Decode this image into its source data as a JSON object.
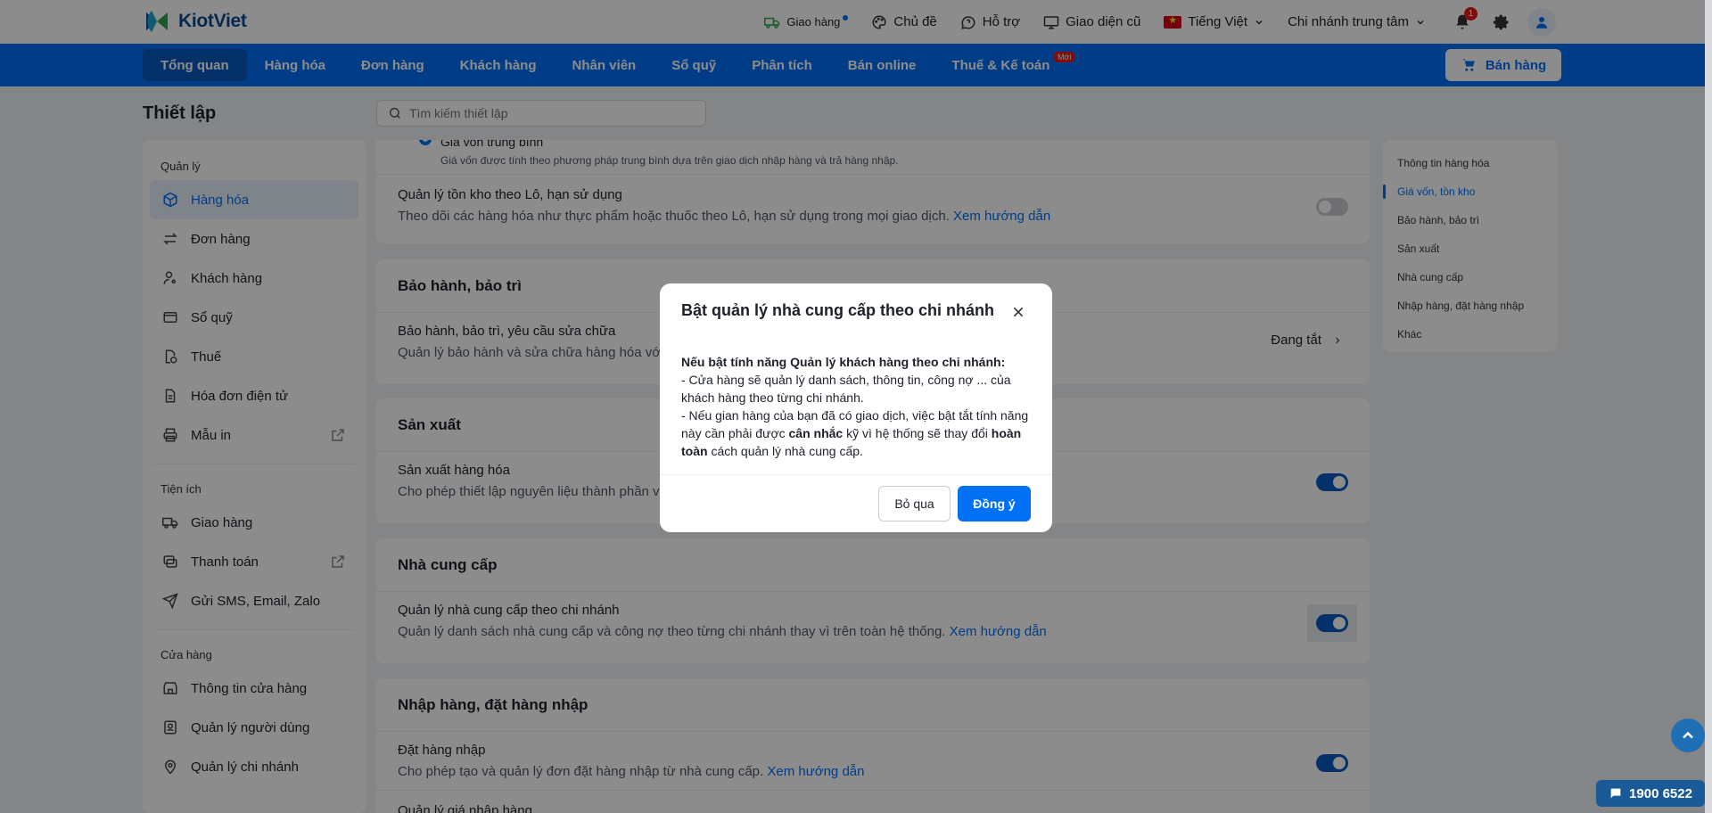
{
  "topbar": {
    "brand": "KiotViet",
    "delivery": "Giao hàng",
    "theme": "Chủ đề",
    "support": "Hỗ trợ",
    "old_ui": "Giao diện cũ",
    "language": "Tiếng Việt",
    "branch": "Chi nhánh trung tâm",
    "notification_count": "1"
  },
  "nav": {
    "items": [
      "Tổng quan",
      "Hàng hóa",
      "Đơn hàng",
      "Khách hàng",
      "Nhân viên",
      "Sổ quỹ",
      "Phân tích",
      "Bán online",
      "Thuế & Kế toán"
    ],
    "new_tag": "Mới",
    "sell_button": "Bán hàng"
  },
  "page": {
    "title": "Thiết lập",
    "search_placeholder": "Tìm kiếm thiết lập"
  },
  "sidebar": {
    "groups": [
      {
        "title": "Quản lý",
        "items": [
          "Hàng hóa",
          "Đơn hàng",
          "Khách hàng",
          "Sổ quỹ",
          "Thuế",
          "Hóa đơn điện tử",
          "Mẫu in"
        ]
      },
      {
        "title": "Tiện ích",
        "items": [
          "Giao hàng",
          "Thanh toán",
          "Gửi SMS, Email, Zalo"
        ]
      },
      {
        "title": "Cửa hàng",
        "items": [
          "Thông tin cửa hàng",
          "Quản lý người dùng",
          "Quản lý chi nhánh"
        ]
      }
    ]
  },
  "content": {
    "cost_option_title": "Giá vốn trung bình",
    "cost_option_desc": "Giá vốn được tính theo phương pháp trung bình dựa trên giao dịch nhập hàng và trả hàng nhập.",
    "lot_title": "Quản lý tồn kho theo Lô, hạn sử dụng",
    "lot_desc": "Theo dõi các hàng hóa như thực phẩm hoặc thuốc theo Lô, hạn sử dụng trong mọi giao dịch.",
    "guide_link": "Xem hướng dẫn",
    "warranty_head": "Bảo hành, bảo trì",
    "warranty_title": "Bảo hành, bảo trì, yêu cầu sửa chữa",
    "warranty_desc": "Quản lý bảo hành và sửa chữa hàng hóa với",
    "warranty_status": "Đang tắt",
    "production_head": "Sản xuất",
    "production_title": "Sản xuất hàng hóa",
    "production_desc": "Cho phép thiết lập nguyên liệu thành phần và",
    "supplier_head": "Nhà cung cấp",
    "supplier_title": "Quản lý nhà cung cấp theo chi nhánh",
    "supplier_desc": "Quản lý danh sách nhà cung cấp và công nợ theo từng chi nhánh thay vì trên toàn hệ thống.",
    "import_head": "Nhập hàng, đặt hàng nhập",
    "import_title": "Đặt hàng nhập",
    "import_desc": "Cho phép tạo và quản lý đơn đặt hàng nhập từ nhà cung cấp.",
    "branch_price_title": "Quản lý giá nhập hàng"
  },
  "toc": {
    "items": [
      "Thông tin hàng hóa",
      "Giá vốn, tồn kho",
      "Bảo hành, bảo trì",
      "Sản xuất",
      "Nhà cung cấp",
      "Nhập hàng, đặt hàng nhập",
      "Khác"
    ],
    "active_index": 1
  },
  "modal": {
    "title": "Bật quản lý nhà cung cấp theo chi nhánh",
    "intro": "Nếu bật tính năng Quản lý khách hàng theo chi nhánh:",
    "point1": "- Cửa hàng sẽ quản lý danh sách, thông tin, công nợ ... của khách hàng theo từng chi nhánh.",
    "point2_a": "- Nếu gian hàng của bạn đã có giao dịch, việc bật tắt tính năng này cần phải được ",
    "point2_bold1": "cân nhắc",
    "point2_b": " kỹ vì hệ thống sẽ thay đổi ",
    "point2_bold2": "hoàn toàn",
    "point2_c": " cách quản lý nhà cung cấp.",
    "cancel": "Bỏ qua",
    "confirm": "Đồng ý"
  },
  "hotline": "1900 6522",
  "colors": {
    "primary": "#0070f4",
    "nav_active": "#0a5ac2",
    "danger": "#e41b17"
  }
}
